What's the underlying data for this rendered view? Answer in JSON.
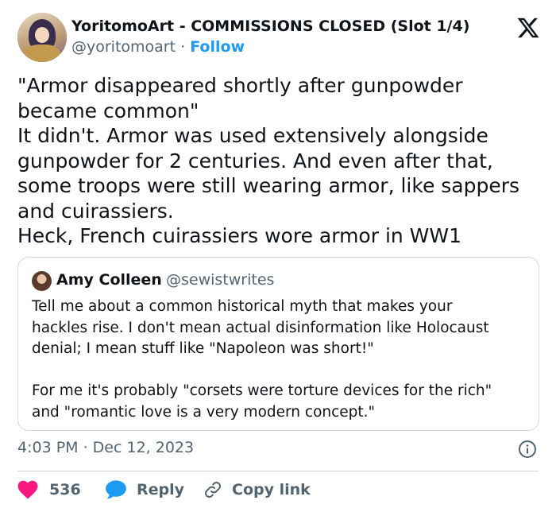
{
  "author": {
    "display_name": "YoritomoArt - COMMISSIONS CLOSED (Slot 1/4)",
    "handle": "@yoritomoart",
    "separator": "·",
    "follow_label": "Follow"
  },
  "tweet": {
    "text": "\"Armor disappeared shortly after gunpowder\nbecame common\"\nIt didn't. Armor was used extensively alongside\ngunpowder for 2 centuries. And even after that,\nsome troops were still wearing armor, like sappers\nand cuirassiers.\nHeck, French cuirassiers wore armor in WW1"
  },
  "quote": {
    "display_name": "Amy Colleen",
    "handle": "@sewistwrites",
    "text": "Tell me about a common historical myth that makes your\nhackles rise. I don't mean actual disinformation like Holocaust\ndenial; I mean stuff like \"Napoleon was short!\"\n\nFor me it's probably \"corsets were torture devices for the rich\"\nand \"romantic love is a very modern concept.\""
  },
  "meta": {
    "timestamp": "4:03 PM · Dec 12, 2023"
  },
  "actions": {
    "likes": "536",
    "reply_label": "Reply",
    "copy_label": "Copy link"
  },
  "colors": {
    "like": "#f91880",
    "reply": "#1d9bf0",
    "link": "#1d9bf0",
    "muted": "#536471"
  }
}
